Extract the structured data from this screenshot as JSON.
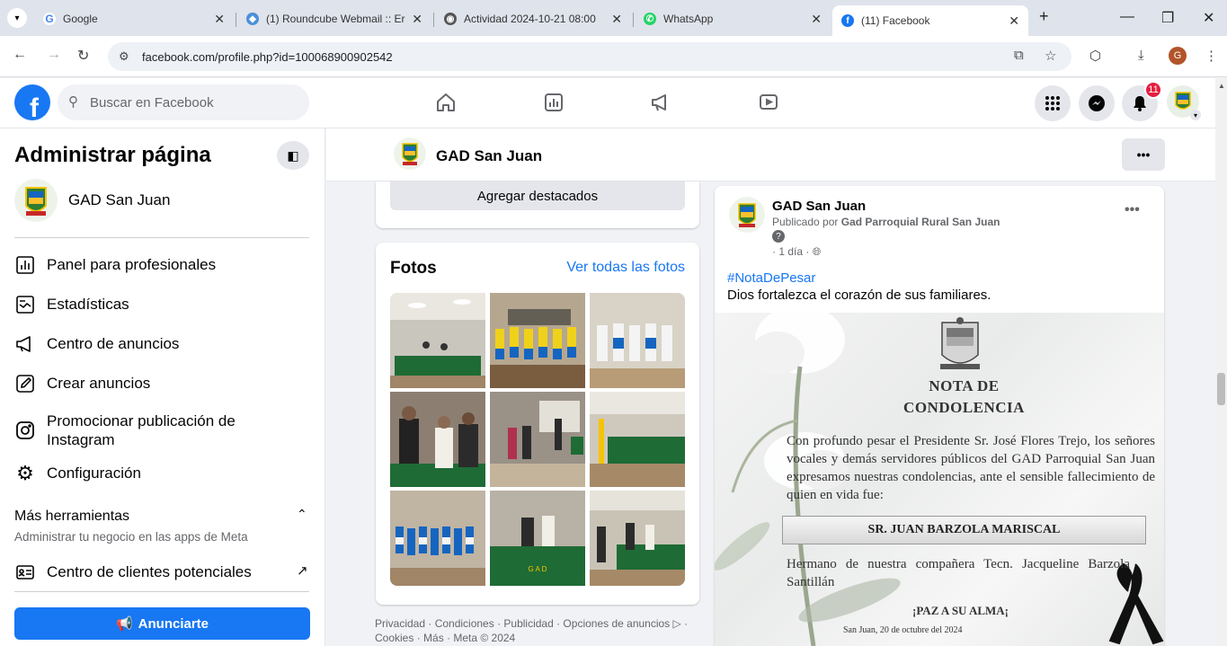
{
  "browser": {
    "tabs": [
      {
        "title": "Google",
        "color": "#4285f4",
        "glyph": "G"
      },
      {
        "title": "(1) Roundcube Webmail :: Er",
        "color": "#4a90d9",
        "glyph": "◆"
      },
      {
        "title": "Actividad 2024-10-21 08:00",
        "color": "#555555",
        "glyph": "◉"
      },
      {
        "title": "WhatsApp",
        "color": "#25d366",
        "glyph": "✆"
      },
      {
        "title": "(11) Facebook",
        "color": "#1877f2",
        "glyph": "f"
      }
    ],
    "url": "facebook.com/profile.php?id=100068900902542",
    "profile_initial": "G"
  },
  "fb": {
    "search_placeholder": "Buscar en Facebook",
    "notification_count": "11"
  },
  "left": {
    "title": "Administrar página",
    "page_name": "GAD San Juan",
    "items": [
      {
        "label": "Panel para profesionales",
        "icon": "dashboard-icon"
      },
      {
        "label": "Estadísticas",
        "icon": "insights-icon"
      },
      {
        "label": "Centro de anuncios",
        "icon": "megaphone-icon"
      },
      {
        "label": "Crear anuncios",
        "icon": "pencil-icon"
      },
      {
        "label": "Promocionar publicación de Instagram",
        "icon": "instagram-icon"
      },
      {
        "label": "Configuración",
        "icon": "gear-icon"
      }
    ],
    "more_title": "Más herramientas",
    "more_sub": "Administrar tu negocio en las apps de Meta",
    "leads_label": "Centro de clientes potenciales",
    "advertise_label": "Anunciarte"
  },
  "pagebar": {
    "name": "GAD San Juan"
  },
  "middle": {
    "featured_button": "Agregar destacados",
    "photos_title": "Fotos",
    "photos_link": "Ver todas las fotos",
    "footer": "Privacidad · Condiciones · Publicidad · Opciones de anuncios ▷ · Cookies · Más · Meta © 2024"
  },
  "post": {
    "author": "GAD San Juan",
    "published_by_prefix": "Publicado por",
    "published_by": "Gad Parroquial Rural San Juan",
    "time": "· 1 día · ",
    "hashtag": "#NotaDePesar",
    "text": "Dios fortalezca el corazón de sus familiares.",
    "image": {
      "title_line1": "NOTA DE",
      "title_line2": "CONDOLENCIA",
      "body": "Con profundo pesar el Presidente Sr. José Flores Trejo, los señores vocales y demás servidores públicos del GAD Parroquial San Juan expresamos nuestras condolencias, ante el sensible fallecimiento de quien en vida fue:",
      "name": "SR. JUAN BARZOLA MARISCAL",
      "body2": "Hermano de nuestra compañera Tecn. Jacqueline Barzola Santillán",
      "closing": "¡PAZ A SU ALMA¡",
      "date": "San Juan, 20 de octubre del 2024"
    }
  }
}
